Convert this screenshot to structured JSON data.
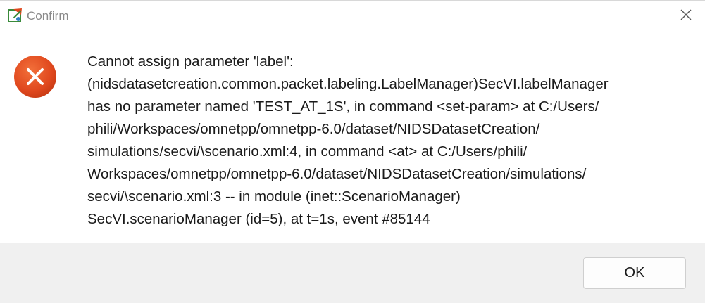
{
  "window": {
    "title": "Confirm",
    "app_icon": "eclipse-app-icon",
    "close_icon": "close-icon"
  },
  "dialog": {
    "icon": "error-icon",
    "icon_color": "#e0481e",
    "message_lines": [
      "Cannot assign parameter 'label':",
      "(nidsdatasetcreation.common.packet.labeling.LabelManager)SecVI.labelManager",
      "has no parameter named 'TEST_AT_1S', in command <set-param> at C:/Users/",
      "phili/Workspaces/omnetpp/omnetpp-6.0/dataset/NIDSDatasetCreation/",
      "simulations/secvi/\\scenario.xml:4, in command <at> at C:/Users/phili/",
      "Workspaces/omnetpp/omnetpp-6.0/dataset/NIDSDatasetCreation/simulations/",
      "secvi/\\scenario.xml:3 -- in module (inet::ScenarioManager)",
      "SecVI.scenarioManager (id=5), at t=1s, event #85144"
    ]
  },
  "buttons": {
    "ok_label": "OK"
  }
}
